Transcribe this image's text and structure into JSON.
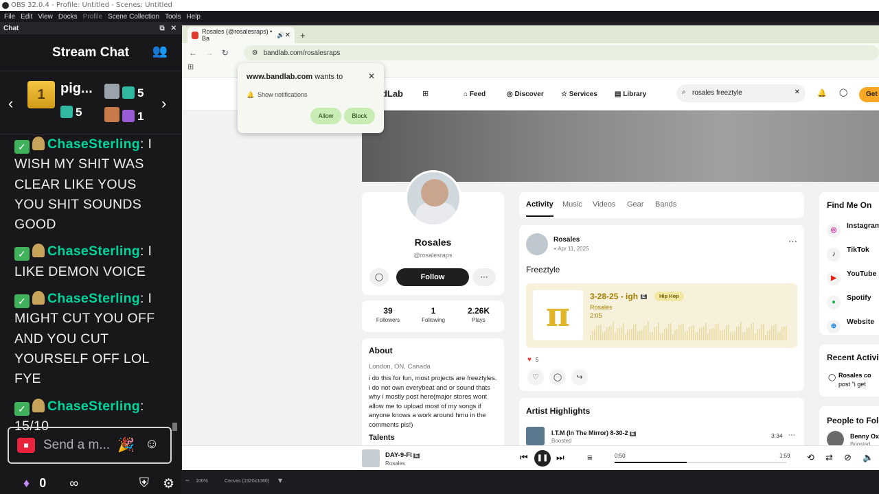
{
  "window": {
    "title": "OBS 32.0.4 - Profile: Untitled - Scenes: Untitled",
    "menu": [
      "File",
      "Edit",
      "View",
      "Docks",
      "Profile",
      "Scene Collection",
      "Tools",
      "Help"
    ]
  },
  "chat_dock": {
    "dock_title": "Chat",
    "stream_title": "Stream Chat",
    "top_gifter": {
      "rank": "1",
      "name": "pig...",
      "count": "5"
    },
    "gifter_2": {
      "rank": "2",
      "count": "5"
    },
    "gifter_3": {
      "rank": "3",
      "count": "1"
    },
    "messages": [
      {
        "user": "ChaseSterling",
        "text": ": I WISH MY SHIT WAS CLEAR LIKE YOUS YOU SHIT SOUNDS GOOD"
      },
      {
        "user": "ChaseSterling",
        "text": ": I LIKE DEMON VOICE"
      },
      {
        "user": "ChaseSterling",
        "text": ": I MIGHT CUT YOU OFF AND YOU CUT YOURSELF OFF LOL FYE"
      },
      {
        "user": "ChaseSterling",
        "text": ": 15/10"
      }
    ],
    "input_placeholder": "Send a m...",
    "points": "0",
    "infinity": "∞"
  },
  "browser": {
    "tab_title": "Rosales (@rosalesraps) • Ba",
    "url": "bandlab.com/rosalesraps",
    "notification": {
      "site": "www.bandlab.com",
      "wants_to": " wants to",
      "description": "Show notifications",
      "allow": "Allow",
      "block": "Block"
    }
  },
  "site": {
    "logo": "ndLab",
    "nav": [
      "Feed",
      "Discover",
      "Services",
      "Library"
    ],
    "search_value": "rosales freeztyle",
    "get_label": "Get",
    "profile": {
      "name": "Rosales",
      "handle": "@rosalesraps",
      "follow": "Follow",
      "stats": [
        {
          "value": "39",
          "label": "Followers"
        },
        {
          "value": "1",
          "label": "Following"
        },
        {
          "value": "2.26K",
          "label": "Plays"
        }
      ]
    },
    "about": {
      "title": "About",
      "location": "London, ON, Canada",
      "bio": "i do this for fun, most projects are freeztyles. i do not own everybeat and or sound thats why i mostly post here(major stores wont allow me to upload most of my songs if anyone knows a work around hmu in the comments pls!)",
      "talents": "Talents"
    },
    "profile_tabs": [
      "Activity",
      "Music",
      "Videos",
      "Gear",
      "Bands"
    ],
    "post": {
      "author": "Rosales",
      "date": "Apr 11, 2025",
      "caption": "Freeztyle",
      "track_title": "3-28-25 - igh",
      "explicit": "E",
      "genre": "Hip Hop",
      "track_artist": "Rosales",
      "duration": "2:05",
      "likes": "5"
    },
    "highlights": {
      "title": "Artist Highlights",
      "track": "I.T.M (In The Mirror) 8-30-2",
      "explicit": "E",
      "sub": "Boosted",
      "duration": "3:34"
    },
    "find_me_on": {
      "title": "Find Me On",
      "links": [
        "Instagram",
        "TikTok",
        "YouTube",
        "Spotify",
        "Website"
      ]
    },
    "recent_activity": {
      "title": "Recent Activity",
      "line1": "Rosales co",
      "line2": "post \"i get"
    },
    "people": {
      "title": "People to Follow",
      "name": "Benny Ox",
      "sub": "Boosted"
    },
    "player": {
      "title": "DAY-9-FI",
      "explicit": "E",
      "artist": "Rosales",
      "elapsed": "0:50",
      "total": "1:59",
      "progress": 0.42
    }
  },
  "obs_bottom": {
    "zoom": "100%",
    "canvas": "Canvas (1920x1080)"
  },
  "colors": {
    "chat_username": "#00d49a",
    "accent_get": "#f9a825",
    "allow_block_bg": "#c9ecb4"
  }
}
